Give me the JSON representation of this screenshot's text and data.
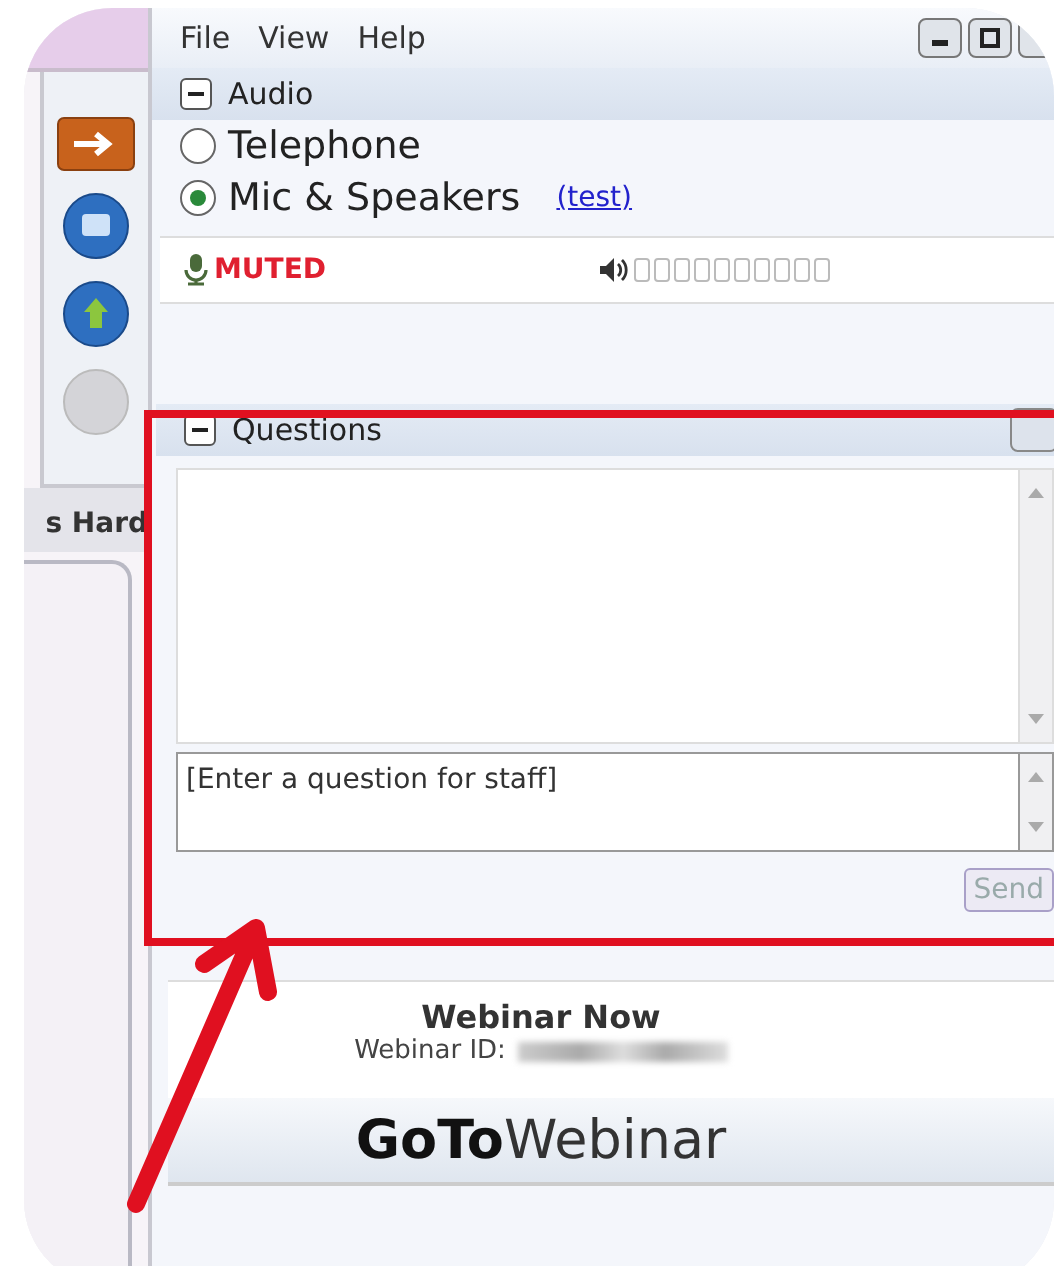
{
  "menu": [
    "File",
    "View",
    "Help"
  ],
  "sidebar": {
    "tab_label": "s Hard"
  },
  "audio": {
    "title": "Audio",
    "expanded": true,
    "options": [
      {
        "label": "Telephone",
        "selected": false
      },
      {
        "label": "Mic & Speakers",
        "selected": true
      }
    ],
    "test_link": "(test)",
    "mic_status": "MUTED"
  },
  "questions": {
    "title": "Questions",
    "expanded": true,
    "input": {
      "placeholder": "[Enter a question for staff]"
    },
    "send_button": {
      "label": "Send",
      "disabled": true
    }
  },
  "webinar": {
    "name": "Webinar Now",
    "id_label": "Webinar ID:"
  },
  "logo": {
    "bold": "GoTo",
    "light": "Webinar"
  }
}
